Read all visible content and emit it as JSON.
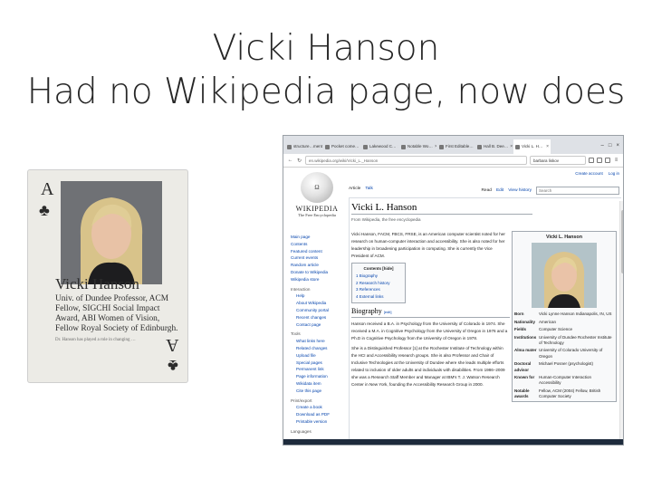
{
  "slide": {
    "title_line1": "Vicki Hanson",
    "title_line2": "Had no Wikipedia page, now does"
  },
  "card": {
    "rank": "A",
    "suit_icon": "club-icon",
    "suit_glyph": "♣",
    "name": "Vicki Hanson",
    "description": "Univ. of Dundee Professor, ACM Fellow, SIGCHI Social Impact Award, ABI Women of Vision, Fellow Royal Society of Edinburgh.",
    "fine_print": "Dr. Hanson has played a role in changing … "
  },
  "browser": {
    "tabs": [
      {
        "label": "structure…mention"
      },
      {
        "label": "Pocket come…"
      },
      {
        "label": "Lakewood C…"
      },
      {
        "label": "Notable Wo…"
      },
      {
        "label": "First Editable…"
      },
      {
        "label": "Hall B. Dee…"
      },
      {
        "label": "Vicki L. H…"
      }
    ],
    "url": "en.wikipedia.org/wiki/Vicki_L._Hanson",
    "search_value": "barbara liskov"
  },
  "wiki": {
    "logo_word": "WIKIPEDIA",
    "logo_tagline": "The Free Encyclopedia",
    "personal_links": [
      "Create account",
      "Log in"
    ],
    "page_tabs_left": [
      "Article",
      "Talk"
    ],
    "page_tabs_right": [
      "Read",
      "Edit",
      "View history"
    ],
    "search_placeholder": "Search",
    "sidebar_main": [
      "Main page",
      "Contents",
      "Featured content",
      "Current events",
      "Random article",
      "Donate to Wikipedia",
      "Wikipedia store"
    ],
    "interaction_head": "Interaction",
    "sidebar_interaction": [
      "Help",
      "About Wikipedia",
      "Community portal",
      "Recent changes",
      "Contact page"
    ],
    "tools_head": "Tools",
    "sidebar_tools": [
      "What links here",
      "Related changes",
      "Upload file",
      "Special pages",
      "Permanent link",
      "Page information",
      "Wikidata item",
      "Cite this page"
    ],
    "print_head": "Print/export",
    "sidebar_print": [
      "Create a book",
      "Download as PDF",
      "Printable version"
    ],
    "languages_head": "Languages",
    "article_title": "Vicki L. Hanson",
    "from_line": "From Wikipedia, the free encyclopedia",
    "intro": "Vicki Hanson, FACM, FBCS, FRSE, is an American computer scientist noted for her research on human-computer interaction and accessibility. She is also noted for her leadership in broadening participation in computing. She is currently the Vice President of ACM.",
    "toc_head": "Contents [hide]",
    "toc_items": [
      "1 Biography",
      "2 Research history",
      "3 References",
      "4 External links"
    ],
    "section_title": "Biography",
    "section_edit": "[edit]",
    "bio_p1": "Hanson received a B.A. in Psychology from the University of Colorado in 1974. She received a M.A. in Cognitive Psychology from the University of Oregon in 1976 and a Ph.D in Cognitive Psychology from the University of Oregon in 1978.",
    "bio_p2": "She is a Distinguished Professor [1] at the Rochester Institute of Technology within the HCI and Accessibility research groups. She is also Professor and Chair of Inclusive Technologies at the University of Dundee where she leads multiple efforts related to inclusion of older adults and individuals with disabilities. From 1986–2009 she was a Research Staff Member and Manager at IBM's T. J. Watson Research Center in New York, founding the Accessibility Research Group in 2000.",
    "infobox": {
      "name": "Vicki L. Hanson",
      "rows": [
        {
          "label": "Born",
          "value": "Vicki Lynne Hanson Indianapolis, IN, US"
        },
        {
          "label": "Nationality",
          "value": "American"
        },
        {
          "label": "Fields",
          "value": "Computer Science"
        },
        {
          "label": "Institutions",
          "value": "University of Dundee Rochester Institute of Technology"
        },
        {
          "label": "Alma mater",
          "value": "University of Colorado University of Oregon"
        },
        {
          "label": "Doctoral advisor",
          "value": "Michael Posner (psychologist)"
        },
        {
          "label": "Known for",
          "value": "Human-Computer Interaction Accessibility"
        },
        {
          "label": "Notable awards",
          "value": "Fellow, ACM (2004) Fellow, British Computer Society"
        }
      ]
    }
  }
}
